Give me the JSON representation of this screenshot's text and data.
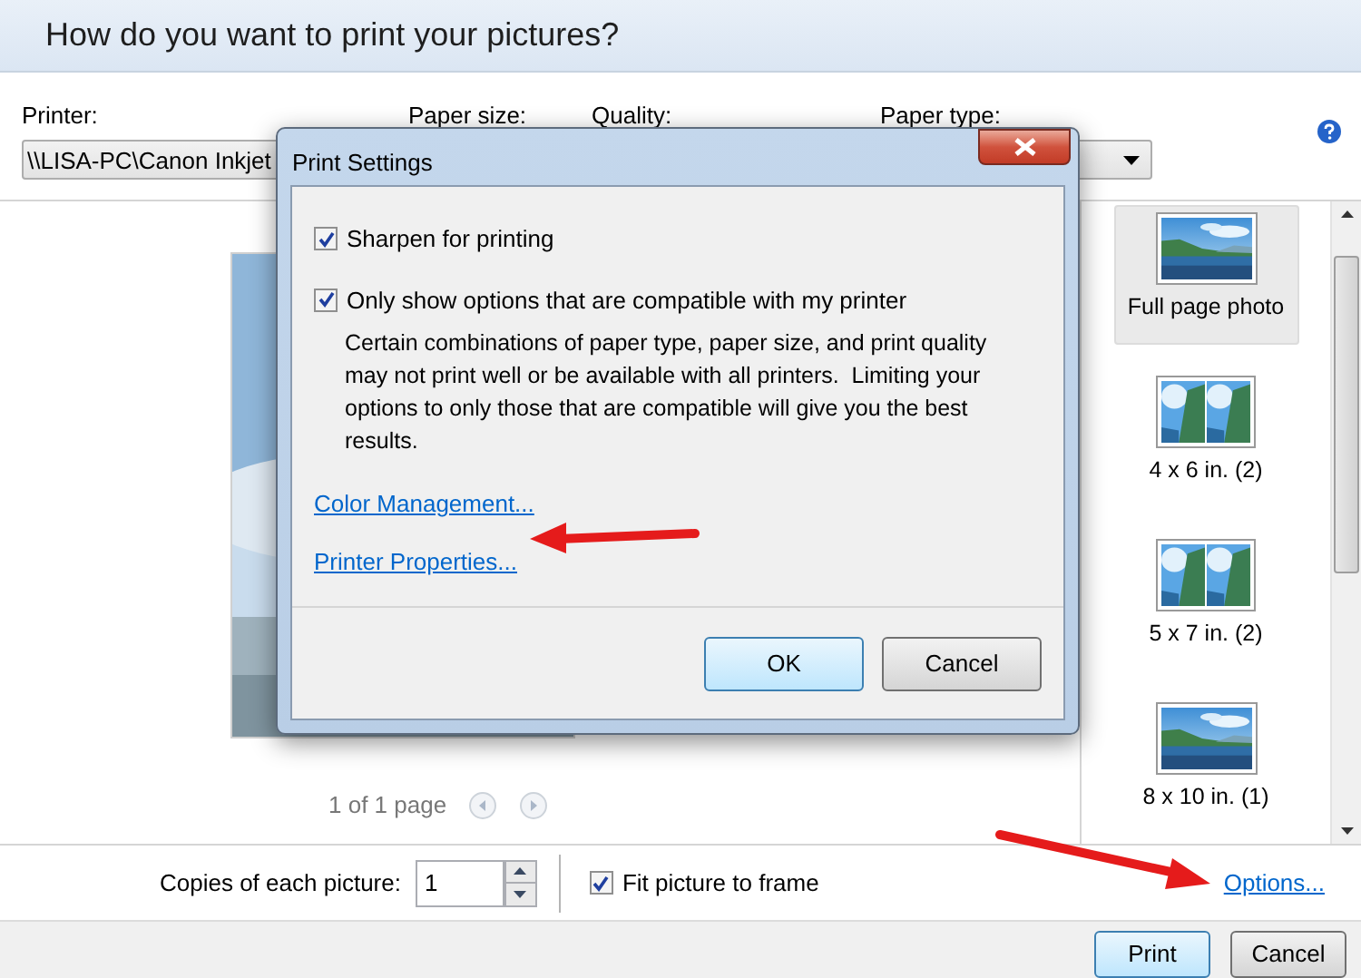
{
  "window": {
    "title": "How do you want to print your pictures?"
  },
  "toolbar": {
    "printer": {
      "label": "Printer:",
      "value": "\\\\LISA-PC\\Canon Inkjet"
    },
    "paper_size": {
      "label": "Paper size:"
    },
    "quality": {
      "label": "Quality:"
    },
    "paper_type": {
      "label": "Paper type:"
    }
  },
  "preview": {
    "pager": "1 of 1 page"
  },
  "layouts": [
    {
      "label": "Full page photo",
      "selected": true,
      "kind": "single"
    },
    {
      "label": "4 x 6 in. (2)",
      "selected": false,
      "kind": "double"
    },
    {
      "label": "5 x 7 in. (2)",
      "selected": false,
      "kind": "double"
    },
    {
      "label": "8 x 10 in. (1)",
      "selected": false,
      "kind": "single"
    }
  ],
  "bottom": {
    "copies_label": "Copies of each picture:",
    "copies_value": "1",
    "fit": {
      "label": "Fit picture to frame",
      "checked": true
    },
    "options_link": "Options..."
  },
  "buttons": [
    {
      "label": "Print",
      "kind": "default"
    },
    {
      "label": "Cancel",
      "kind": "normal"
    }
  ],
  "dialog": {
    "title": "Print Settings",
    "options": [
      {
        "label": "Sharpen for printing",
        "checked": true
      },
      {
        "label": "Only show options that are compatible with my printer",
        "checked": true,
        "description": "Certain combinations of paper type, paper size, and print quality may not print well or be available with all printers.  Limiting your options to only those that are compatible will give you the best results."
      }
    ],
    "links": [
      "Color Management...",
      "Printer Properties..."
    ],
    "buttons": [
      {
        "label": "OK",
        "kind": "default"
      },
      {
        "label": "Cancel",
        "kind": "normal"
      }
    ]
  }
}
